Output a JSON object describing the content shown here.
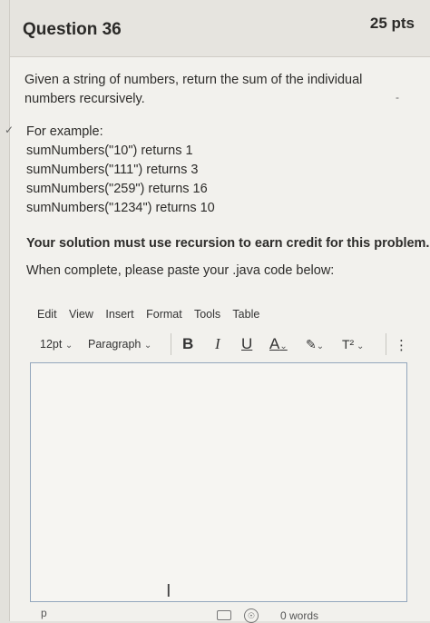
{
  "question": {
    "title": "Question 36",
    "points": "25 pts",
    "prompt": "Given a string of numbers, return the sum of the individual numbers recursively.",
    "examples_heading": "For example:",
    "examples": [
      "sumNumbers(\"10\") returns 1",
      "sumNumbers(\"111\") returns 3",
      "sumNumbers(\"259\") returns 16",
      "sumNumbers(\"1234\") returns 10"
    ],
    "recursion_note": "Your solution must use recursion to earn credit for this problem.",
    "instruction": "When complete, please paste your .java code below:"
  },
  "editor": {
    "menu": [
      "Edit",
      "View",
      "Insert",
      "Format",
      "Tools",
      "Table"
    ],
    "font_size": "12pt",
    "block_format": "Paragraph",
    "bold_label": "B",
    "italic_label": "I",
    "underline_label": "U",
    "font_color_label": "A",
    "highlight_label": "✎",
    "superscript_label": "T²",
    "more_label": "⋮",
    "status_path": "p",
    "word_count": "0 words"
  },
  "colors": {
    "editor_border": "#93a6bd",
    "header_bg": "#e6e4df"
  }
}
